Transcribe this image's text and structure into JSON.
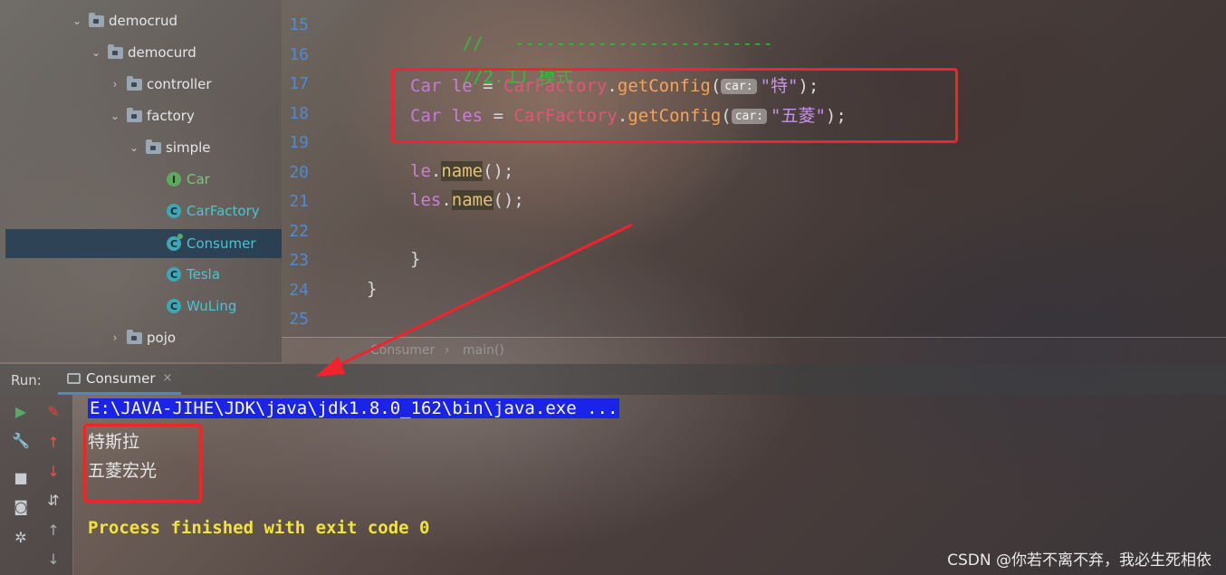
{
  "project_tree": {
    "items": [
      {
        "label": "democrud",
        "kind": "folder",
        "expanded": true
      },
      {
        "label": "democurd",
        "kind": "folder",
        "expanded": true
      },
      {
        "label": "controller",
        "kind": "folder",
        "expanded": false
      },
      {
        "label": "factory",
        "kind": "folder",
        "expanded": true
      },
      {
        "label": "simple",
        "kind": "folder",
        "expanded": true
      },
      {
        "label": "Car",
        "kind": "interface",
        "icon_letter": "I"
      },
      {
        "label": "CarFactory",
        "kind": "class",
        "icon_letter": "C"
      },
      {
        "label": "Consumer",
        "kind": "class",
        "icon_letter": "C",
        "selected": true
      },
      {
        "label": "Tesla",
        "kind": "class",
        "icon_letter": "C"
      },
      {
        "label": "WuLing",
        "kind": "class",
        "icon_letter": "C"
      },
      {
        "label": "pojo",
        "kind": "folder",
        "expanded": false
      }
    ]
  },
  "editor": {
    "line_numbers": [
      "15",
      "16",
      "17",
      "18",
      "19",
      "20",
      "21",
      "22",
      "23",
      "24",
      "25"
    ],
    "line15": {
      "comment": "//   -------------------------"
    },
    "line16": {
      "comment": "//2.工厂模式"
    },
    "line17": {
      "type": "Car",
      "var": "le",
      "eq": "=",
      "factory": "CarFactory",
      "dot": ".",
      "method": "getConfig",
      "open": "(",
      "hint": "car:",
      "arg": "\"特\"",
      "close": ");"
    },
    "line18": {
      "type": "Car",
      "var": "les",
      "eq": "=",
      "factory": "CarFactory",
      "dot": ".",
      "method": "getConfig",
      "open": "(",
      "hint": "car:",
      "arg": "\"五菱\"",
      "close": ");"
    },
    "line20": {
      "obj": "le",
      "dot": ".",
      "method": "name",
      "rest": "();"
    },
    "line21": {
      "obj": "les",
      "dot": ".",
      "method": "name",
      "rest": "();"
    },
    "line23": "}",
    "line24": "}"
  },
  "breadcrumb": {
    "items": [
      "Consumer",
      "main()"
    ],
    "separator": "›"
  },
  "run_panel": {
    "label": "Run:",
    "tab": {
      "label": "Consumer",
      "close": "×"
    },
    "toolbar_icons": [
      "play-icon",
      "wrench-icon",
      "stop-icon",
      "camera-icon",
      "bug-settings-icon",
      "edit-icon",
      "up-arrow-icon",
      "down-arrow-icon",
      "sort-icon",
      "up-icon",
      "down-icon"
    ],
    "console": {
      "command": "E:\\JAVA-JIHE\\JDK\\java\\jdk1.8.0_162\\bin\\java.exe ...",
      "output": [
        "特斯拉",
        "五菱宏光"
      ],
      "exit_message": "Process finished with exit code 0"
    }
  },
  "watermark": "CSDN @你若不离不弃，我必生死相依",
  "colors": {
    "annotation": "#f0232e",
    "line_numbers": "#4f8ad3",
    "command_highlight": "#1a23e8",
    "exit_text": "#f2e43a"
  }
}
